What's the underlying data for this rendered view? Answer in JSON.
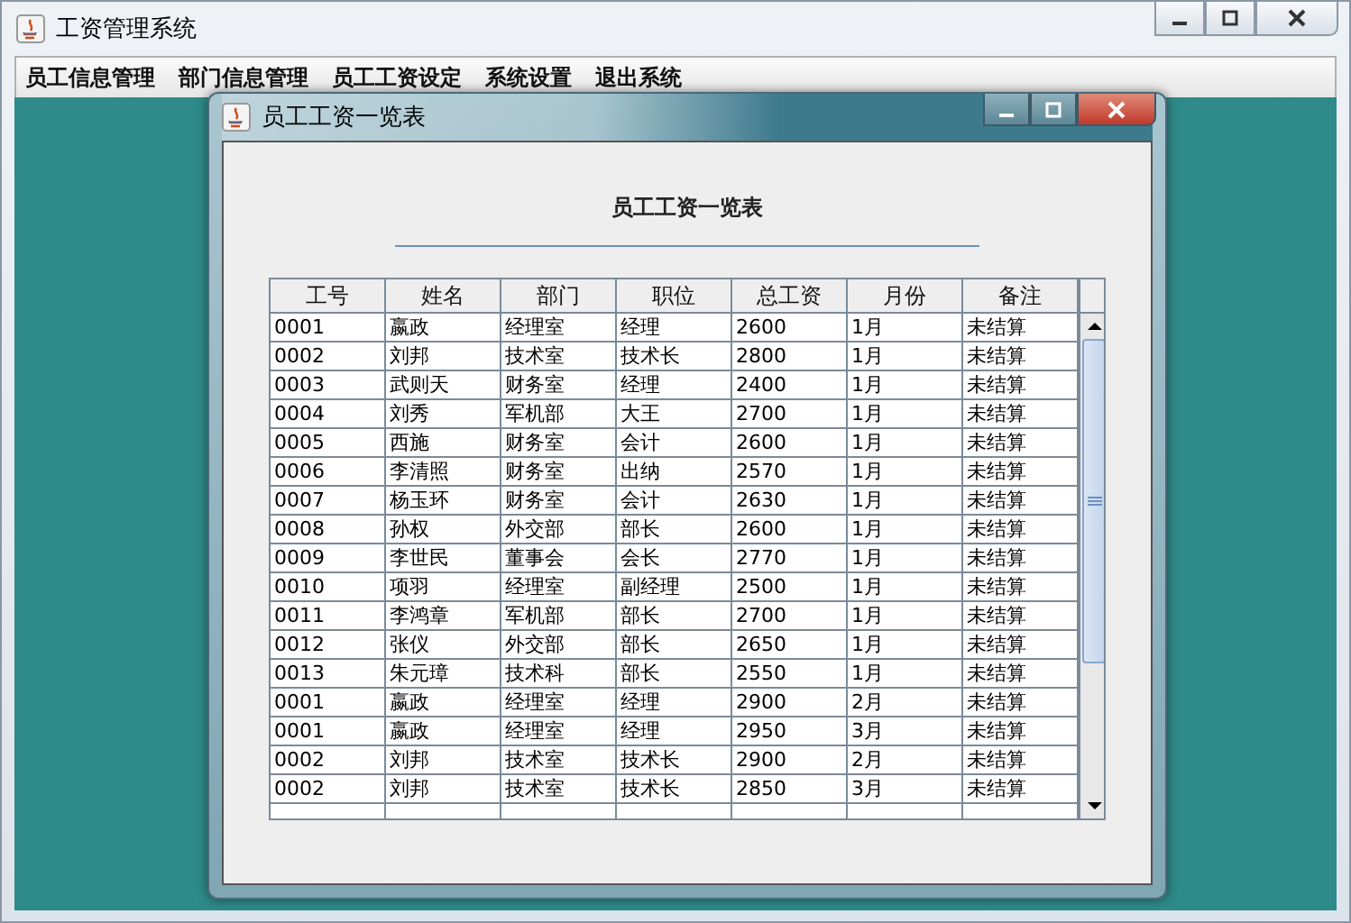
{
  "window": {
    "title": "工资管理系统"
  },
  "menu": [
    "员工信息管理",
    "部门信息管理",
    "员工工资设定",
    "系统设置",
    "退出系统"
  ],
  "inner_window": {
    "title": "员工工资一览表"
  },
  "heading": "员工工资一览表",
  "table": {
    "columns": [
      "工号",
      "姓名",
      "部门",
      "职位",
      "总工资",
      "月份",
      "备注"
    ],
    "rows": [
      [
        "0001",
        "嬴政",
        "经理室",
        "经理",
        "2600",
        "1月",
        "未结算"
      ],
      [
        "0002",
        "刘邦",
        "技术室",
        "技术长",
        "2800",
        "1月",
        "未结算"
      ],
      [
        "0003",
        "武则天",
        "财务室",
        "经理",
        "2400",
        "1月",
        "未结算"
      ],
      [
        "0004",
        "刘秀",
        "军机部",
        "大王",
        "2700",
        "1月",
        "未结算"
      ],
      [
        "0005",
        "西施",
        "财务室",
        "会计",
        "2600",
        "1月",
        "未结算"
      ],
      [
        "0006",
        "李清照",
        "财务室",
        "出纳",
        "2570",
        "1月",
        "未结算"
      ],
      [
        "0007",
        "杨玉环",
        "财务室",
        "会计",
        "2630",
        "1月",
        "未结算"
      ],
      [
        "0008",
        "孙权",
        "外交部",
        "部长",
        "2600",
        "1月",
        "未结算"
      ],
      [
        "0009",
        "李世民",
        "董事会",
        "会长",
        "2770",
        "1月",
        "未结算"
      ],
      [
        "0010",
        "项羽",
        "经理室",
        "副经理",
        "2500",
        "1月",
        "未结算"
      ],
      [
        "0011",
        "李鸿章",
        "军机部",
        "部长",
        "2700",
        "1月",
        "未结算"
      ],
      [
        "0012",
        "张仪",
        "外交部",
        "部长",
        "2650",
        "1月",
        "未结算"
      ],
      [
        "0013",
        "朱元璋",
        "技术科",
        "部长",
        "2550",
        "1月",
        "未结算"
      ],
      [
        "0001",
        "嬴政",
        "经理室",
        "经理",
        "2900",
        "2月",
        "未结算"
      ],
      [
        "0001",
        "嬴政",
        "经理室",
        "经理",
        "2950",
        "3月",
        "未结算"
      ],
      [
        "0002",
        "刘邦",
        "技术室",
        "技术长",
        "2900",
        "2月",
        "未结算"
      ],
      [
        "0002",
        "刘邦",
        "技术室",
        "技术长",
        "2850",
        "3月",
        "未结算"
      ]
    ]
  }
}
